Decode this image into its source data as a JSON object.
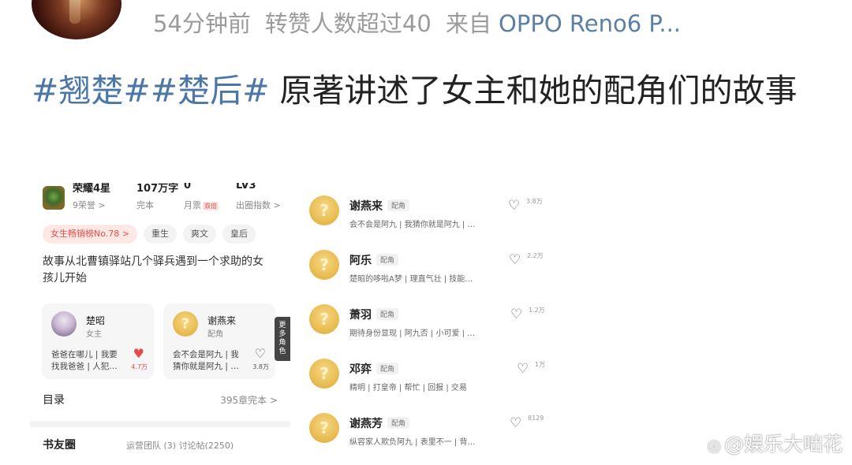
{
  "header": {
    "time": "54分钟前",
    "reposts": "转赞人数超过40",
    "source_prefix": "来自",
    "device": "OPPO Reno6 P..."
  },
  "post": {
    "tag1": "#翘楚#",
    "tag2": "#楚后#",
    "text": " 原著讲述了女主和她的配角们的故事"
  },
  "book_card": {
    "stats": [
      {
        "top": "荣耀4星",
        "bottom": "9荣誉 >"
      },
      {
        "top": "107万字",
        "bottom": "完本"
      },
      {
        "top": "0",
        "bottom": "月票",
        "badge": "双倍"
      },
      {
        "top": "LV3",
        "bottom": "出圈指数 >"
      }
    ],
    "chips": [
      "女生畅销榜No.78 >",
      "重生",
      "爽文",
      "皇后"
    ],
    "intro": "故事从北曹镇驿站几个驿兵遇到一个求助的女孩儿开始",
    "roles": [
      {
        "name": "楚昭",
        "role": "女主",
        "line1": "爸爸在哪儿 | 我要",
        "line2": "找我爸爸 | 人犯…",
        "likes": "4.7万"
      },
      {
        "name": "谢燕来",
        "role": "配角",
        "line1": "会不会是阿九 | 我",
        "line2": "猜你就是阿九 | …",
        "likes": "3.8万"
      }
    ],
    "more_roles": "更多角色",
    "catalog_label": "目录",
    "catalog_count": "395章完本 >",
    "bookfriends_label": "书友圈",
    "bookfriends_stats": "运营团队 (3)   讨论帖(2250)"
  },
  "characters": [
    {
      "name": "谢燕来",
      "tag": "配角",
      "desc": "会不会是阿九 | 我猜你就是阿九 | …",
      "likes": "3.8万"
    },
    {
      "name": "阿乐",
      "tag": "配角",
      "desc": "楚昭的哆啦A梦 | 理直气壮 | 技能…",
      "likes": "2.2万"
    },
    {
      "name": "萧羽",
      "tag": "配角",
      "desc": "期待身份显现 | 阿九否 | 小可爱 | …",
      "likes": "1.2万"
    },
    {
      "name": "邓弈",
      "tag": "配角",
      "desc": "精明 | 打皇帝 | 帮忙 | 回报 | 交易",
      "likes": "1万"
    },
    {
      "name": "谢燕芳",
      "tag": "配角",
      "desc": "纵容家人欺负阿九 | 表里不一 | 背…",
      "likes": "8129"
    }
  ],
  "watermark": "@娱乐大咄花",
  "icons": {
    "heart": "heart-icon",
    "weibo": "weibo-logo-icon"
  },
  "colors": {
    "tag_blue": "#4a77a8",
    "meta_gray": "#9b9b9b",
    "like_red": "#e84a4a"
  }
}
